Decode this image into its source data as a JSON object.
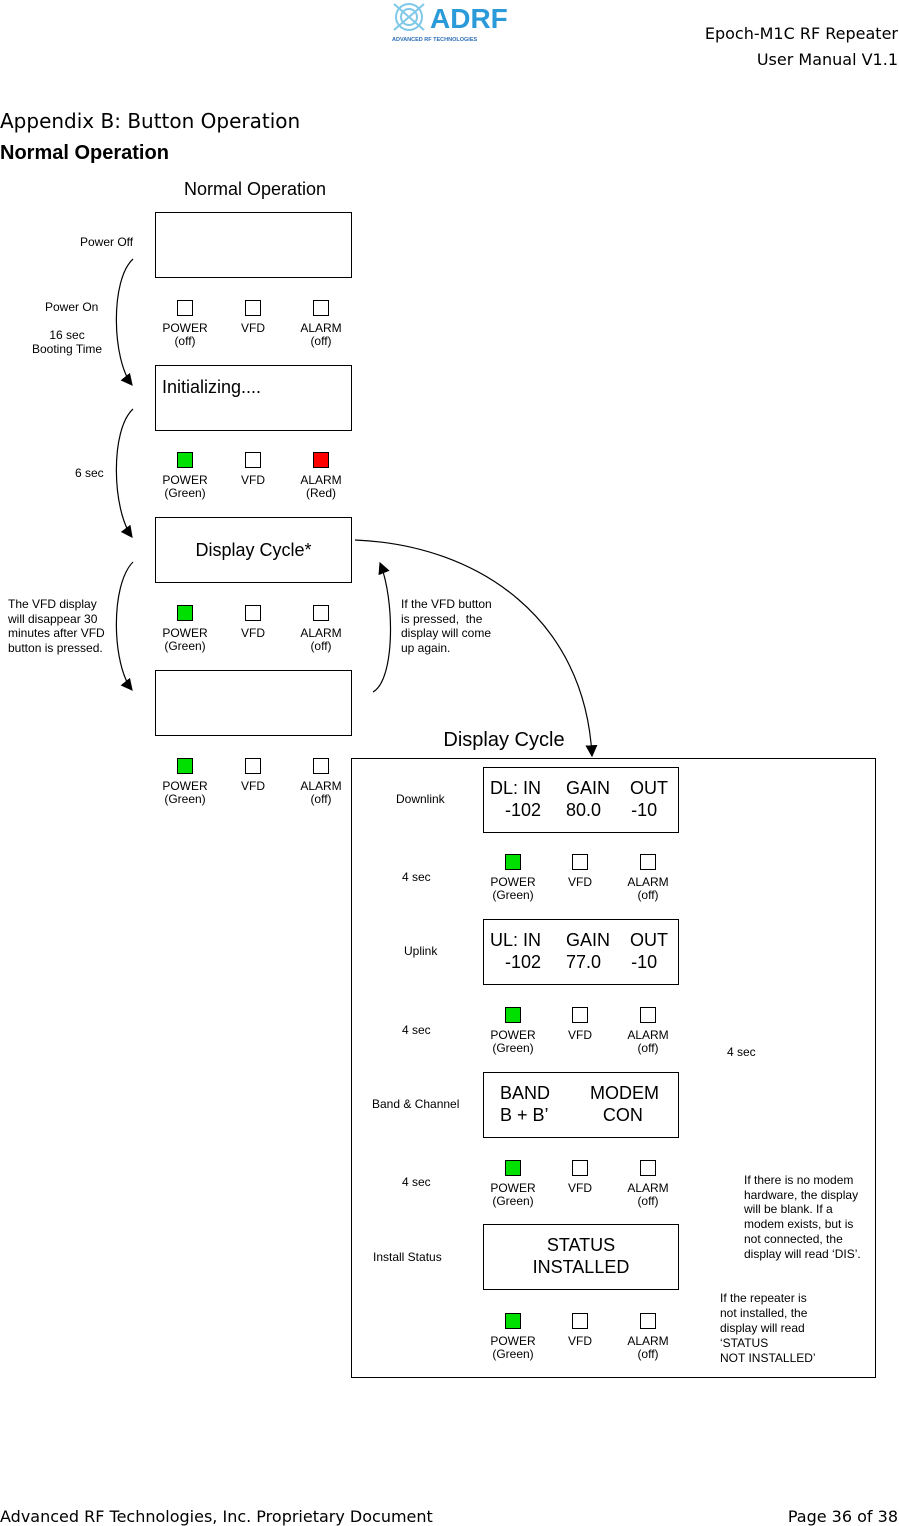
{
  "header": {
    "logo_text": "ADRF",
    "logo_subtext": "ADVANCED RF TECHNOLOGIES",
    "title": "Epoch-M1C RF Repeater",
    "subtitle": "User Manual V1.1"
  },
  "section": {
    "title": "Appendix B: Button Operation",
    "subtitle": "Normal Operation"
  },
  "diagram": {
    "title": "Normal Operation",
    "left_labels": {
      "power_off": "Power Off",
      "power_on": "Power On",
      "booting": "16 sec\nBooting Time",
      "six_sec": "6 sec",
      "vfd_note": "The VFD display\nwill disappear 30\nminutes after VFD\nbutton is pressed.",
      "vfd_pressed": "If the VFD button\nis pressed,  the\ndisplay will come\nup again."
    },
    "states": [
      {
        "screen": "",
        "leds": [
          {
            "label": "POWER",
            "state": "(off)",
            "color": "#ffffff"
          },
          {
            "label": "VFD",
            "state": "",
            "color": "#ffffff"
          },
          {
            "label": "ALARM",
            "state": "(off)",
            "color": "#ffffff"
          }
        ]
      },
      {
        "screen": "Initializing....",
        "leds": [
          {
            "label": "POWER",
            "state": "(Green)",
            "color": "#00e000"
          },
          {
            "label": "VFD",
            "state": "",
            "color": "#ffffff"
          },
          {
            "label": "ALARM",
            "state": "(Red)",
            "color": "#ff0000"
          }
        ]
      },
      {
        "screen": "Display Cycle*",
        "leds": [
          {
            "label": "POWER",
            "state": "(Green)",
            "color": "#00e000"
          },
          {
            "label": "VFD",
            "state": "",
            "color": "#ffffff"
          },
          {
            "label": "ALARM",
            "state": "(off)",
            "color": "#ffffff"
          }
        ]
      },
      {
        "screen": "",
        "leds": [
          {
            "label": "POWER",
            "state": "(Green)",
            "color": "#00e000"
          },
          {
            "label": "VFD",
            "state": "",
            "color": "#ffffff"
          },
          {
            "label": "ALARM",
            "state": "(off)",
            "color": "#ffffff"
          }
        ]
      }
    ]
  },
  "cycle": {
    "title": "Display Cycle",
    "labels": {
      "downlink": "Downlink",
      "uplink": "Uplink",
      "band": "Band & Channel",
      "install": "Install Status",
      "sec1": "4 sec",
      "sec2": "4 sec",
      "sec3": "4 sec",
      "sec_loop": "4 sec"
    },
    "screens": [
      {
        "l1": "DL: IN     GAIN    OUT",
        "l2": "   -102     80.0      -10"
      },
      {
        "l1": "UL: IN     GAIN    OUT",
        "l2": "   -102     77.0      -10"
      },
      {
        "l1": "BAND        MODEM",
        "l2": "B + B’           CON"
      },
      {
        "l1": "STATUS",
        "l2": "INSTALLED"
      }
    ],
    "leds": [
      {
        "label": "POWER",
        "state": "(Green)",
        "color": "#00e000"
      },
      {
        "label": "VFD",
        "state": "",
        "color": "#ffffff"
      },
      {
        "label": "ALARM",
        "state": "(off)",
        "color": "#ffffff"
      }
    ],
    "notes": {
      "modem": "If there is no modem\nhardware, the display\nwill be blank. If a\nmodem exists, but is\nnot connected, the\ndisplay will read ‘DIS’.",
      "install": "If the repeater is\nnot installed, the\ndisplay will read\n‘STATUS\nNOT INSTALLED’"
    }
  },
  "footer": {
    "left": "Advanced RF Technologies, Inc. Proprietary Document",
    "right": "Page 36 of 38"
  }
}
